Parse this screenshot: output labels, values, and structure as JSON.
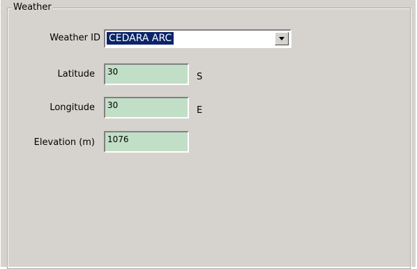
{
  "weather_group": {
    "title": "Weather",
    "weather_id": {
      "label": "Weather ID",
      "selected": "CEDARA ARC"
    },
    "latitude": {
      "label": "Latitude",
      "value": "30",
      "unit": "S"
    },
    "longitude": {
      "label": "Longitude",
      "value": "30",
      "unit": "E"
    },
    "elevation": {
      "label": "Elevation (m)",
      "value": "1076"
    }
  },
  "colors": {
    "panel_bg": "#d6d3ce",
    "field_bg": "#c1dfc6",
    "selection_bg": "#0a246a"
  },
  "icons": {
    "dropdown": "chevron-down-icon"
  }
}
